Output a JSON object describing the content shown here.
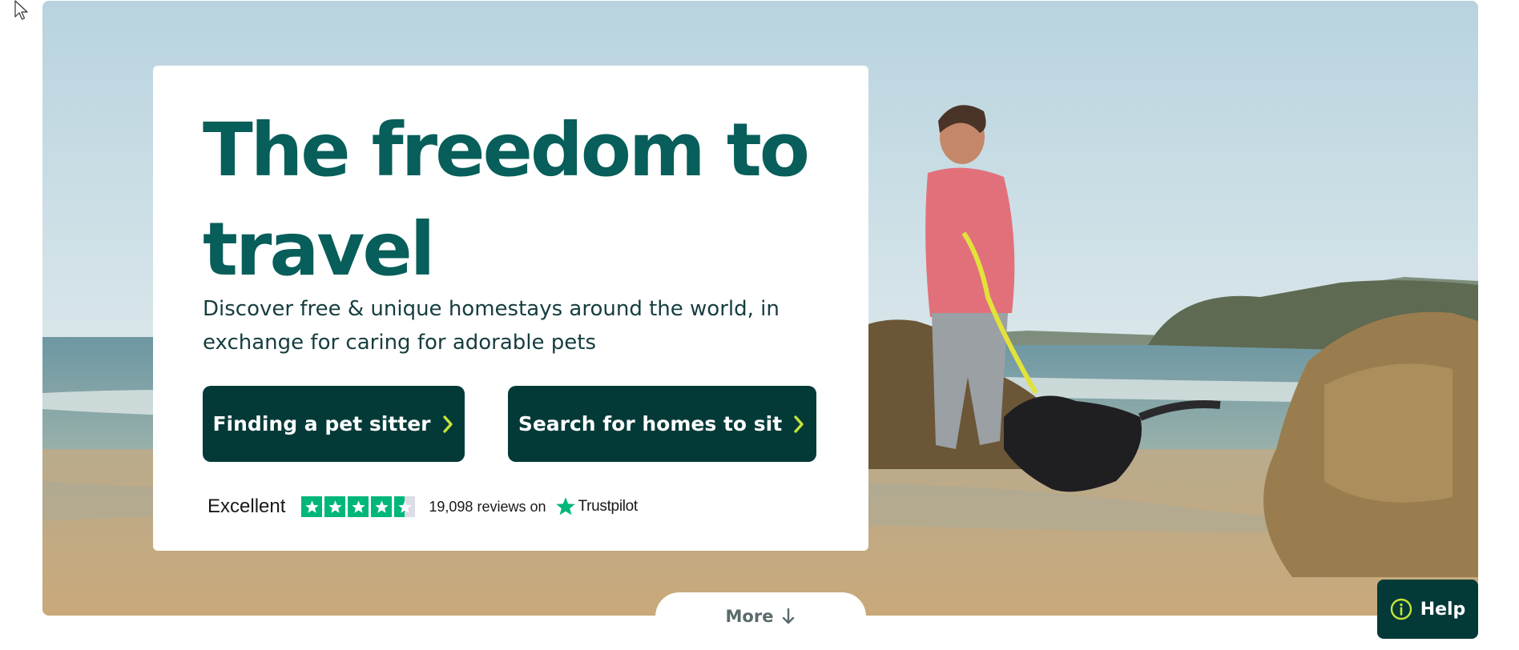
{
  "hero": {
    "headline": "The freedom to travel",
    "subtitle": "Discover free & unique homestays around the world, in exchange for caring for adorable pets",
    "image": "woman-and-dog-on-beach"
  },
  "buttons": {
    "find_sitter": "Finding a pet sitter",
    "search_homes": "Search for homes to sit"
  },
  "trustpilot": {
    "rating_word": "Excellent",
    "stars": 4.5,
    "reviews_text": "19,098 reviews on",
    "brand": "Trustpilot",
    "star_color": "#00b67a"
  },
  "more": {
    "label": "More"
  },
  "help": {
    "label": "Help"
  },
  "colors": {
    "brand_dark": "#033a38",
    "headline": "#075e5a",
    "accent": "#c6e23a"
  },
  "icons": {
    "cursor": "cursor-arrow-icon",
    "chevron": "chevron-right-icon",
    "more": "arrow-down-icon",
    "help": "info-circle-icon"
  }
}
